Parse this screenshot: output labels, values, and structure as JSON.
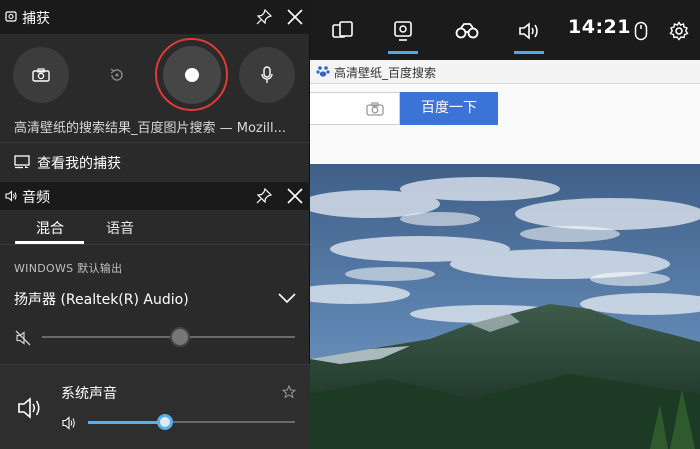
{
  "browser": {
    "tab_title": "高清壁纸_百度搜索",
    "search_button": "百度一下"
  },
  "topbar": {
    "clock": "14:21",
    "icons": [
      "widget-menu-icon",
      "capture-icon",
      "performance-icon",
      "audio-icon",
      "mouse-icon",
      "settings-icon"
    ]
  },
  "capture": {
    "title": "捕获",
    "window_title": "高清壁纸的搜索结果_百度图片搜索 — Mozill...",
    "view_captures": "查看我的捕获",
    "record_ring_color": "#e03a3a"
  },
  "audio": {
    "title": "音频",
    "tabs": [
      "混合",
      "语音"
    ],
    "active_tab": "混合",
    "windows_default_output": "WINDOWS 默认输出",
    "device": "扬声器 (Realtek(R) Audio)",
    "master_volume": 0.55,
    "master_muted": true,
    "apps": [
      {
        "name": "系统声音",
        "volume": 0.36,
        "accent": "#58b0ea"
      }
    ]
  }
}
